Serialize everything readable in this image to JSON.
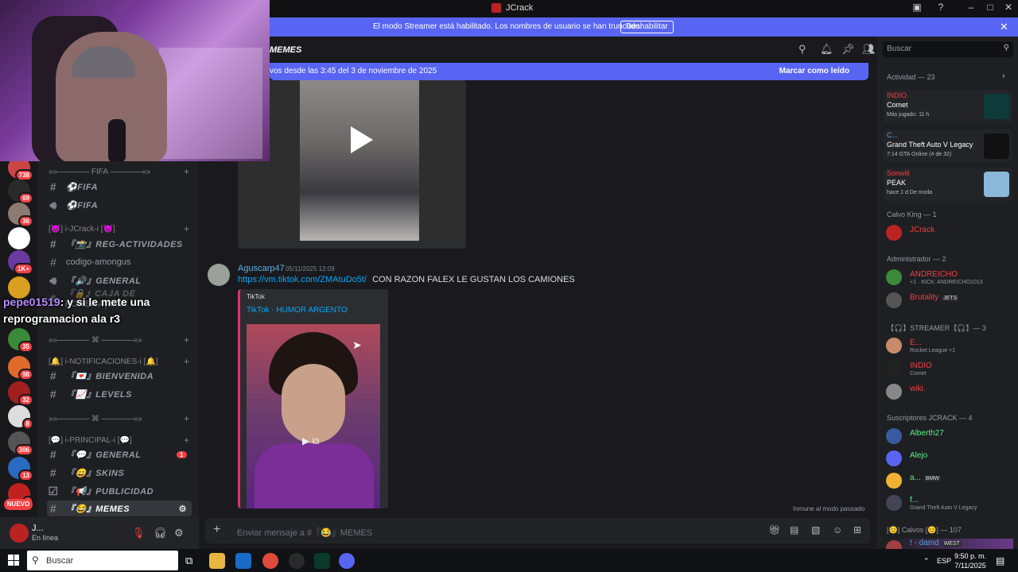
{
  "window": {
    "title": "JCrack"
  },
  "banner": {
    "text": "El modo Streamer está habilitado. Los nombres de usuario se han truncado.",
    "button": "Deshabilitar"
  },
  "webcam_overlay": {
    "user": "pepe01519",
    "message": ": y si le mete una reprogramacion ala r3"
  },
  "servers": [
    {
      "badge": "738"
    },
    {
      "badge": "69"
    },
    {
      "badge": "36"
    },
    {
      "badge": ""
    },
    {
      "badge": "1K+"
    },
    {
      "badge": ""
    },
    {
      "badge": ""
    },
    {
      "badge": "35"
    },
    {
      "badge": "98"
    },
    {
      "badge": "32"
    },
    {
      "badge": "8"
    },
    {
      "badge": "306"
    },
    {
      "badge": "13"
    },
    {
      "badge": "1"
    }
  ],
  "servers_new": "NUEVO",
  "channels": {
    "cat_fifa": "»»———— FIFA ————«»",
    "fifa_1": "⚽FIFA",
    "fifa_2": "⚽FIFA",
    "cat_jcrack": "[😈] i-JCrack-i [😈]",
    "reg": "『📸』REG-ACTIVIDADES",
    "amongus": "codigo-amongus",
    "general_voice": "『🔊』GENERAL",
    "caja": "『🔒』CAJA DE FORERA|CON",
    "cat_sep1": "»»———— ⌘ ————«»",
    "cat_notif": "[🔔] i-NOTIFICACIONES-i [🔔]",
    "bienvenida": "『💌』BIENVENIDA",
    "levels": "『📈』LEVELS",
    "cat_sep2": "»»———— ⌘ ————«»",
    "cat_principal": "[💬] i-PRINCIPAL-i [💬]",
    "general": "『💬』GENERAL",
    "general_count": "1",
    "skins": "『😄』SKINS",
    "publicidad": "『📢』PUBLICIDAD",
    "memes": "『😂』MEMES"
  },
  "user_panel": {
    "name": "J...",
    "status": "En línea"
  },
  "header": {
    "channel": "MEMES"
  },
  "new_messages": {
    "text": "vos desde las 3:45 del 3 de noviembre de 2025",
    "action": "Marcar como leído"
  },
  "message": {
    "author": "Aguscarp47",
    "time": "05/11/2025 12:09",
    "link": "https://vm.tiktok.com/ZMAtuDo5t/",
    "text": "CON RAZON FALEX LE GUSTAN LOS CAMIONES",
    "embed_provider": "TikTok",
    "embed_title": "TikTok · HUMOR ARGENTO"
  },
  "paused_note": "Inmune al modo pausado",
  "composer": {
    "placeholder": "Enviar mensaje a #『😂』MEMES"
  },
  "members": {
    "search": "Buscar",
    "activity_head": "Actividad — 23",
    "activities": [
      {
        "user": "INDIO",
        "game": "Comet",
        "sub": "Más jugado: 11 h",
        "user_color": "#f23f43"
      },
      {
        "user": "C...",
        "game": "Grand Theft Auto V Legacy",
        "sub": "7:14  GTA Online (4 de 32)",
        "user_color": "#5ba0e0"
      },
      {
        "user": "Sonwill",
        "game": "PEAK",
        "sub": "hace 1 d   De moda",
        "user_color": "#f23f43"
      }
    ],
    "groups": [
      {
        "label": "Calvo King — 1"
      },
      {
        "label": "Administrador — 2"
      },
      {
        "label": "【🎧】STREAMER【🎧】— 3"
      },
      {
        "label": "Suscriptores JCRACK — 4"
      },
      {
        "label": "[😊] Calvos [😊] — 107"
      }
    ],
    "list": [
      {
        "name": "JCrack",
        "sub": "",
        "tag": "",
        "color": "#f23f43"
      },
      {
        "name": "ANDREICHO",
        "sub": "+1 · KICK: ANDREICHO1013",
        "tag": "",
        "color": "#f23f43"
      },
      {
        "name": "Brutality",
        "sub": "",
        "tag": "JETS",
        "color": "#f23f43"
      },
      {
        "name": "E...",
        "sub": "Rocket League +1",
        "tag": "",
        "color": "#f23f43"
      },
      {
        "name": "INDIO",
        "sub": "Comet",
        "tag": "",
        "color": "#f23f43"
      },
      {
        "name": "wiki.",
        "sub": "",
        "tag": "",
        "color": "#f23f43"
      },
      {
        "name": "Alberth27",
        "sub": "",
        "tag": "",
        "color": "#57f287"
      },
      {
        "name": "Alejo",
        "sub": "",
        "tag": "",
        "color": "#57f287"
      },
      {
        "name": "a...",
        "sub": "",
        "tag": "BMW",
        "color": "#57f287"
      },
      {
        "name": "f...",
        "sub": "Grand Theft Auto V Legacy",
        "tag": "",
        "color": "#57f287"
      },
      {
        "name": "! - damd",
        "sub": "",
        "tag": "WEST",
        "color": "#5ba0e0"
      }
    ]
  },
  "taskbar": {
    "search": "Buscar",
    "lang": "ESP",
    "time": "9:50 p. m.",
    "date": "7/11/2025"
  }
}
